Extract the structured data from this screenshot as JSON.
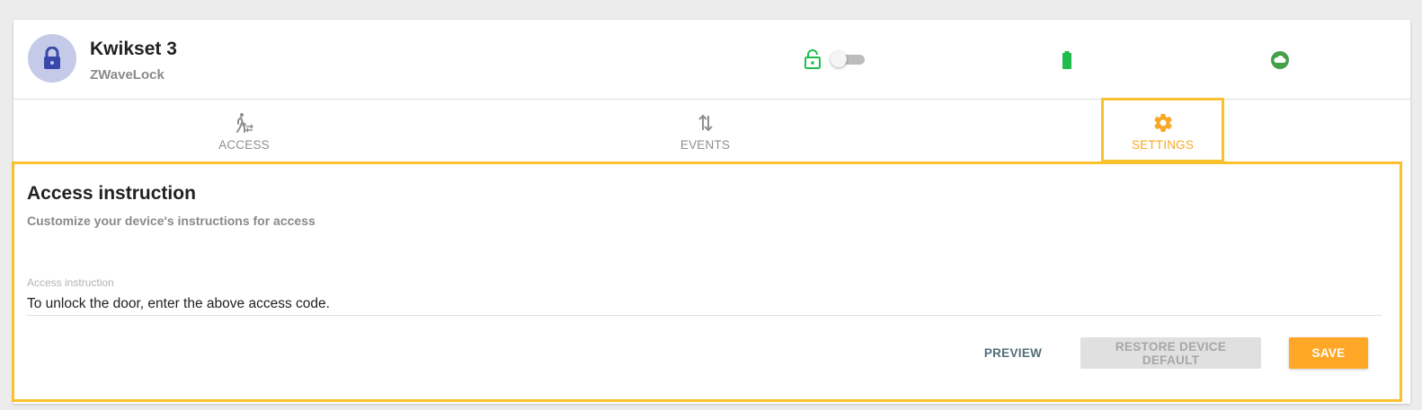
{
  "device": {
    "name": "Kwikset 3",
    "type": "ZWaveLock",
    "avatar_icon": "lock-icon",
    "lock_status_icon": "lock-open-icon",
    "lock_toggle_on": false,
    "battery_icon": "battery-full-icon",
    "connection_icon": "cloud-icon"
  },
  "colors": {
    "accent": "#fbc02d",
    "status_green": "#1fbd4b",
    "avatar_bg": "#c5cae9",
    "avatar_icon": "#3949ab",
    "save_button": "#ffa726"
  },
  "tabs": [
    {
      "label": "ACCESS",
      "icon": "person-access-icon"
    },
    {
      "label": "EVENTS",
      "icon": "swap-vert-icon"
    },
    {
      "label": "SETTINGS",
      "icon": "gear-icon",
      "selected": true
    }
  ],
  "settings": {
    "title": "Access instruction",
    "subtitle": "Customize your device's instructions for access",
    "field_label": "Access instruction",
    "field_value": "To unlock the door, enter the above access code."
  },
  "buttons": {
    "preview": "PREVIEW",
    "restore": "RESTORE DEVICE DEFAULT",
    "save": "SAVE"
  }
}
